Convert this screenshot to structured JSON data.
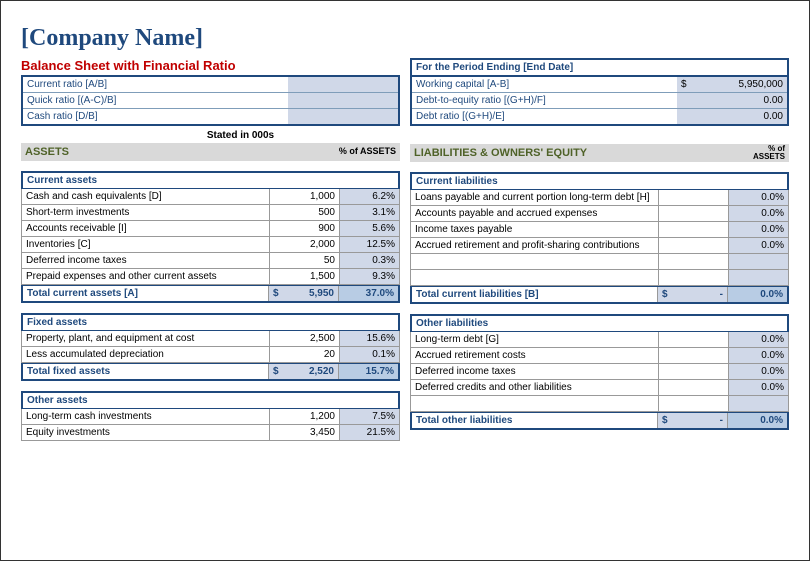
{
  "title": "[Company Name]",
  "subtitle": "Balance Sheet with Financial Ratio",
  "period_label": "For the Period Ending [End Date]",
  "left_ratios": [
    {
      "label": "Current ratio  [A/B]",
      "value": ""
    },
    {
      "label": "Quick ratio  [(A-C)/B]",
      "value": ""
    },
    {
      "label": "Cash ratio  [D/B]",
      "value": ""
    }
  ],
  "right_ratios": [
    {
      "label": "Working capital  [A-B]",
      "value": "5,950,000",
      "dollar": true
    },
    {
      "label": "Debt-to-equity ratio  [(G+H)/F]",
      "value": "0.00"
    },
    {
      "label": "Debt ratio  [(G+H)/E]",
      "value": "0.00"
    }
  ],
  "stated": "Stated in 000s",
  "assets_header": "ASSETS",
  "pct_assets": "% of ASSETS",
  "liab_header": "LIABILITIES & OWNERS' EQUITY",
  "current_assets": {
    "head": "Current assets",
    "rows": [
      {
        "label": "Cash and cash equivalents  [D]",
        "num": "1,000",
        "pct": "6.2%"
      },
      {
        "label": "Short-term investments",
        "num": "500",
        "pct": "3.1%"
      },
      {
        "label": "Accounts receivable  [I]",
        "num": "900",
        "pct": "5.6%"
      },
      {
        "label": "Inventories  [C]",
        "num": "2,000",
        "pct": "12.5%"
      },
      {
        "label": "Deferred income taxes",
        "num": "50",
        "pct": "0.3%"
      },
      {
        "label": "Prepaid expenses and other current assets",
        "num": "1,500",
        "pct": "9.3%"
      }
    ],
    "total": {
      "label": "Total current assets  [A]",
      "num": "5,950",
      "pct": "37.0%"
    }
  },
  "fixed_assets": {
    "head": "Fixed assets",
    "rows": [
      {
        "label": "Property, plant, and equipment at cost",
        "num": "2,500",
        "pct": "15.6%"
      },
      {
        "label": "Less accumulated depreciation",
        "num": "20",
        "pct": "0.1%"
      }
    ],
    "total": {
      "label": "Total fixed assets",
      "num": "2,520",
      "pct": "15.7%"
    }
  },
  "other_assets": {
    "head": "Other assets",
    "rows": [
      {
        "label": "Long-term cash investments",
        "num": "1,200",
        "pct": "7.5%"
      },
      {
        "label": "Equity investments",
        "num": "3,450",
        "pct": "21.5%"
      }
    ]
  },
  "current_liab": {
    "head": "Current liabilities",
    "rows": [
      {
        "label": "Loans payable and current portion long-term debt  [H]",
        "num": "",
        "pct": "0.0%"
      },
      {
        "label": "Accounts payable and accrued expenses",
        "num": "",
        "pct": "0.0%"
      },
      {
        "label": "Income taxes payable",
        "num": "",
        "pct": "0.0%"
      },
      {
        "label": "Accrued retirement and profit-sharing contributions",
        "num": "",
        "pct": "0.0%"
      }
    ],
    "total": {
      "label": "Total current liabilities  [B]",
      "num": "-",
      "pct": "0.0%"
    }
  },
  "other_liab": {
    "head": "Other liabilities",
    "rows": [
      {
        "label": "Long-term debt  [G]",
        "num": "",
        "pct": "0.0%"
      },
      {
        "label": "Accrued retirement costs",
        "num": "",
        "pct": "0.0%"
      },
      {
        "label": "Deferred income taxes",
        "num": "",
        "pct": "0.0%"
      },
      {
        "label": "Deferred credits and other liabilities",
        "num": "",
        "pct": "0.0%"
      }
    ],
    "total": {
      "label": "Total other liabilities",
      "num": "-",
      "pct": "0.0%"
    }
  }
}
